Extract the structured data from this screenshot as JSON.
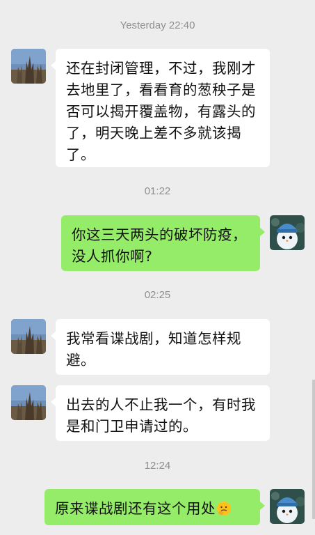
{
  "conversation": {
    "timestamps": [
      "Yesterday 22:40",
      "01:22",
      "02:25",
      "12:24"
    ],
    "messages": [
      {
        "direction": "incoming",
        "text": "还在封闭管理，不过，我刚才去地里了，看看育的葱秧子是否可以揭开覆盖物，有露头的了，明天晚上差不多就该揭了。"
      },
      {
        "direction": "outgoing",
        "text": "你这三天两头的破坏防疫，没人抓你啊?"
      },
      {
        "direction": "incoming",
        "text": "我常看谍战剧，知道怎样规避。"
      },
      {
        "direction": "incoming",
        "text": "出去的人不止我一个，有时我是和门卫申请过的。"
      },
      {
        "direction": "outgoing",
        "text": "原来谍战剧还有这个用处",
        "emoji": "thinking-face-icon"
      }
    ]
  },
  "colors": {
    "background": "#ededed",
    "incoming_bubble": "#ffffff",
    "outgoing_bubble": "#95ec69",
    "timestamp_text": "#8f8f8f"
  }
}
